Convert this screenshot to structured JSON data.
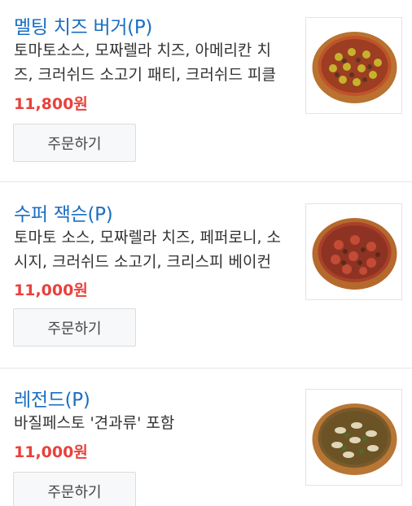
{
  "menu": {
    "items": [
      {
        "name": "멜팅 치즈 버거(P)",
        "description": "토마토소스, 모짜렐라 치즈, 아메리칸 치즈, 크러쉬드 소고기 패티, 크러쉬드 피클",
        "price": "11,800원",
        "order_label": "주문하기",
        "image_icon": "pizza-burger-image"
      },
      {
        "name": "수퍼 잭슨(P)",
        "description": "토마토 소스, 모짜렐라 치즈, 페퍼로니, 소시지, 크러쉬드 소고기, 크리스피 베이컨",
        "price": "11,000원",
        "order_label": "주문하기",
        "image_icon": "pizza-meat-image"
      },
      {
        "name": "레전드(P)",
        "description": "바질페스토 '견과류' 포함",
        "price": "11,000원",
        "order_label": "주문하기",
        "image_icon": "pizza-pesto-image"
      }
    ]
  },
  "colors": {
    "title": "#1b6ec2",
    "price": "#e8413c",
    "button_bg": "#f7f8fa"
  }
}
